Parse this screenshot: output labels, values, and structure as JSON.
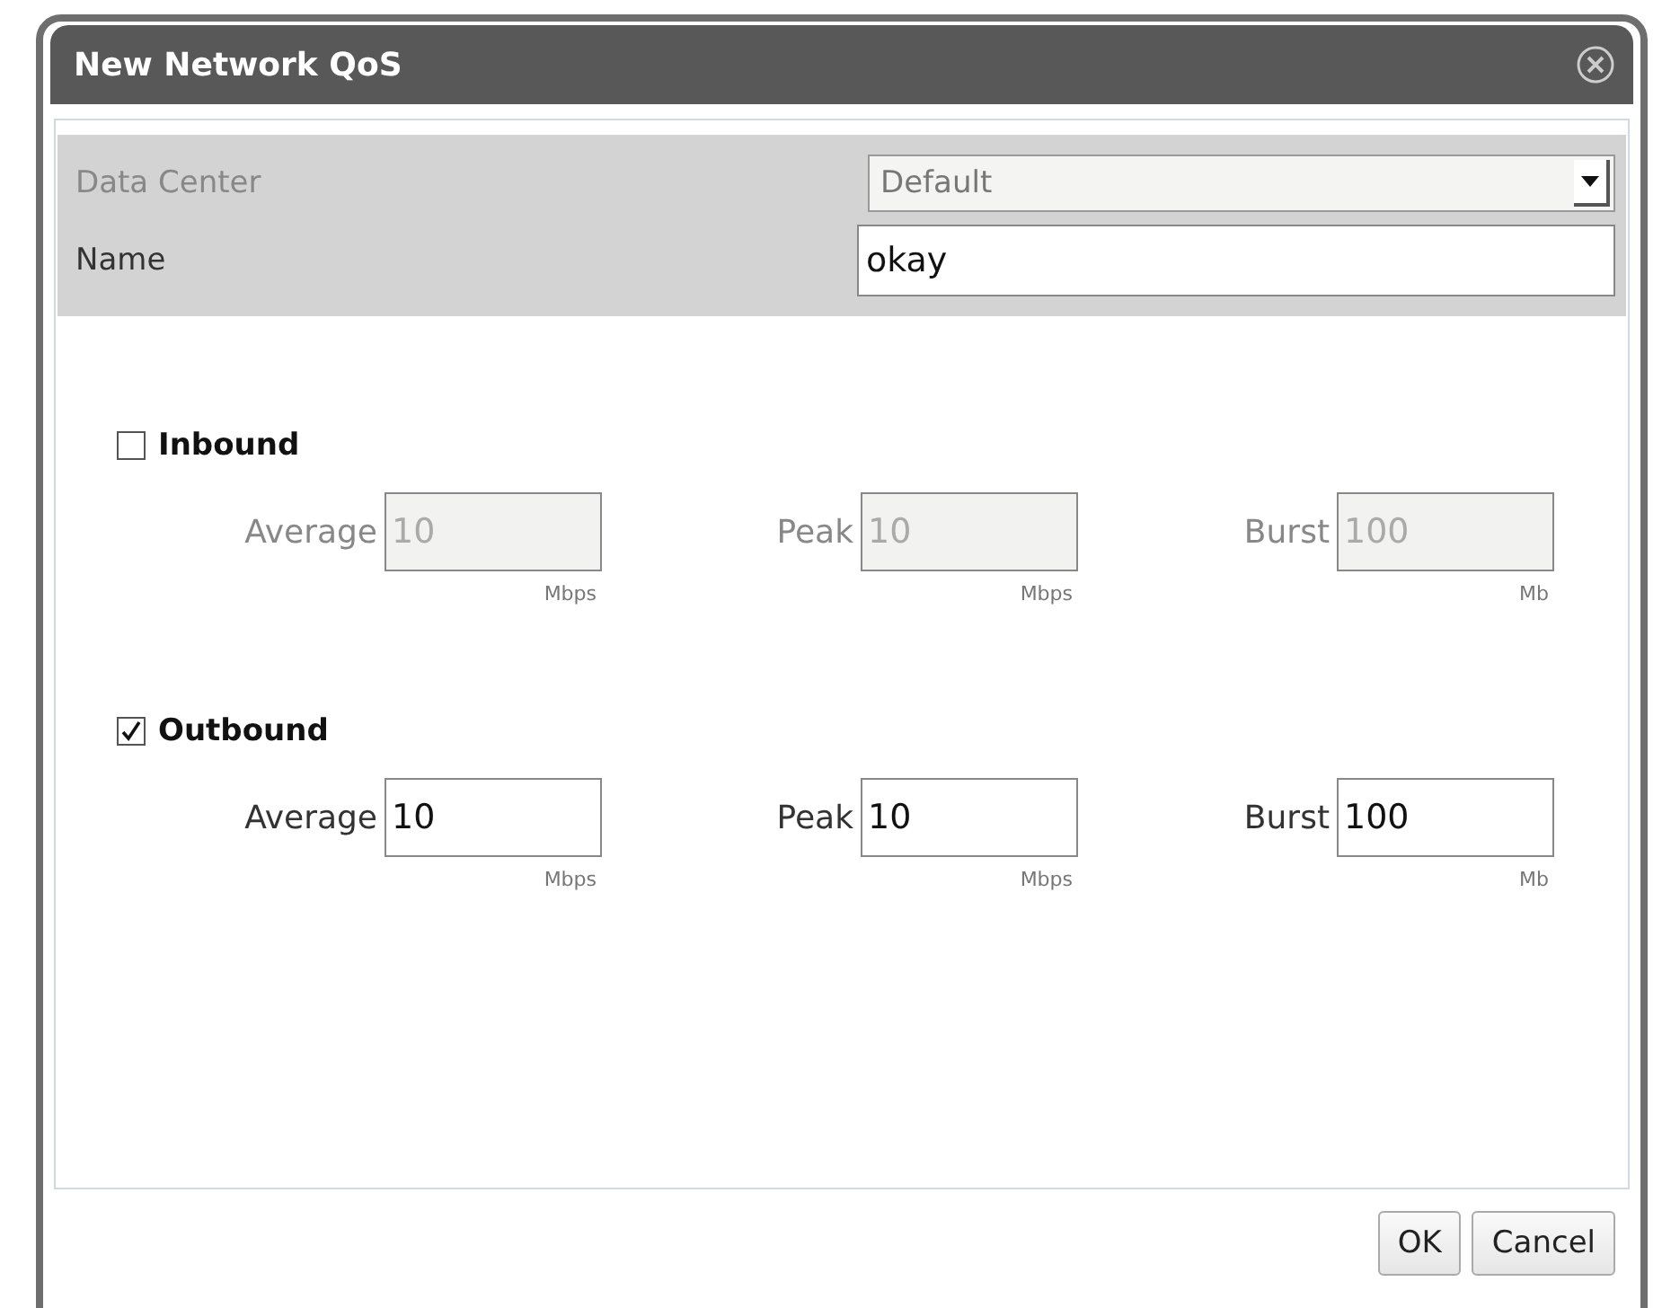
{
  "window": {
    "title": "New Network QoS"
  },
  "general": [
    {
      "label": "Data Center",
      "kind": "select",
      "value": "Default",
      "disabled": true
    },
    {
      "label": "Name",
      "kind": "text",
      "value": "okay",
      "disabled": false
    }
  ],
  "sections": [
    {
      "label": "Inbound",
      "checked": false,
      "fields": [
        {
          "label": "Average",
          "value": "10",
          "unit": "Mbps"
        },
        {
          "label": "Peak",
          "value": "10",
          "unit": "Mbps"
        },
        {
          "label": "Burst",
          "value": "100",
          "unit": "Mb"
        }
      ]
    },
    {
      "label": "Outbound",
      "checked": true,
      "fields": [
        {
          "label": "Average",
          "value": "10",
          "unit": "Mbps"
        },
        {
          "label": "Peak",
          "value": "10",
          "unit": "Mbps"
        },
        {
          "label": "Burst",
          "value": "100",
          "unit": "Mb"
        }
      ]
    }
  ],
  "buttons": [
    "OK",
    "Cancel"
  ]
}
